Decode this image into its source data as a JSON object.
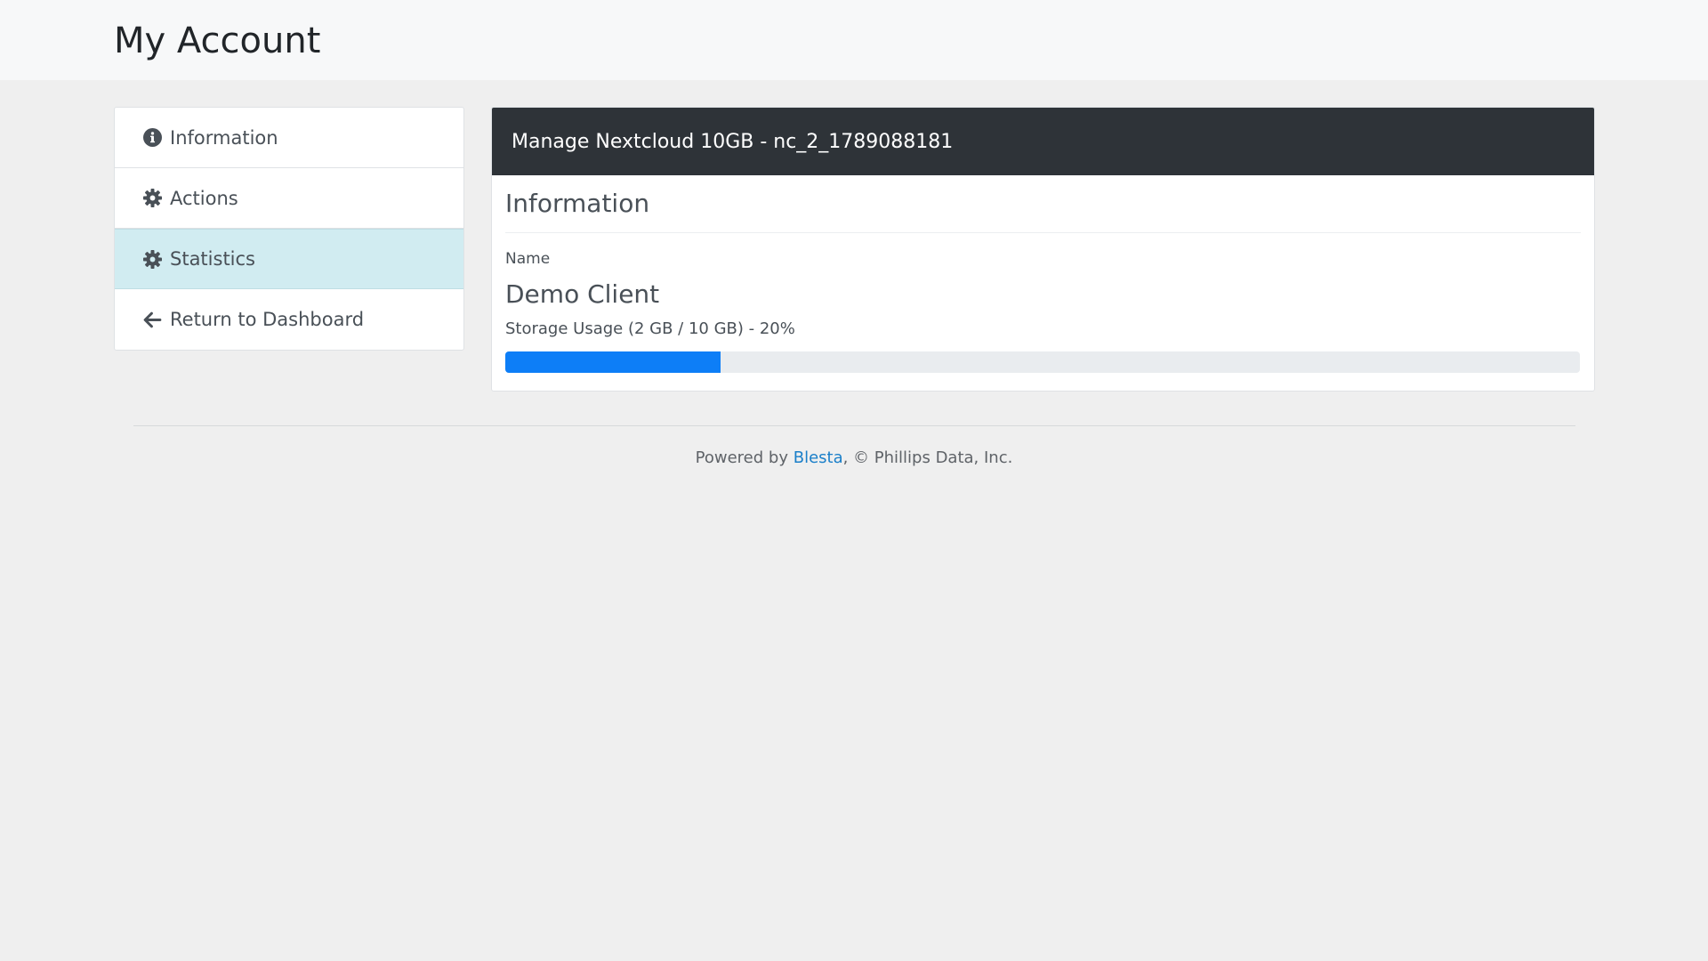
{
  "header": {
    "title": "My Account"
  },
  "sidebar": {
    "items": [
      {
        "label": "Information",
        "icon": "info-circle-icon",
        "active": false
      },
      {
        "label": "Actions",
        "icon": "gear-icon",
        "active": false
      },
      {
        "label": "Statistics",
        "icon": "gear-icon",
        "active": true
      },
      {
        "label": "Return to Dashboard",
        "icon": "arrow-left-icon",
        "active": false
      }
    ]
  },
  "panel": {
    "heading": "Manage Nextcloud 10GB - nc_2_1789088181",
    "section_title": "Information",
    "name_label": "Name",
    "name_value": "Demo Client",
    "storage_label": "Storage Usage (2 GB / 10 GB) - 20%",
    "storage_used_fraction": 0.2
  },
  "footer": {
    "prefix": "Powered by ",
    "link_text": "Blesta",
    "suffix": ", © Phillips Data, Inc."
  },
  "colors": {
    "header_bg": "#f7f8f9",
    "page_bg": "#efefef",
    "panel_heading_bg": "#2e3338",
    "active_item_bg": "#d1ecf1",
    "progress_fill": "#0d7ef7",
    "link": "#1a7fc9"
  }
}
